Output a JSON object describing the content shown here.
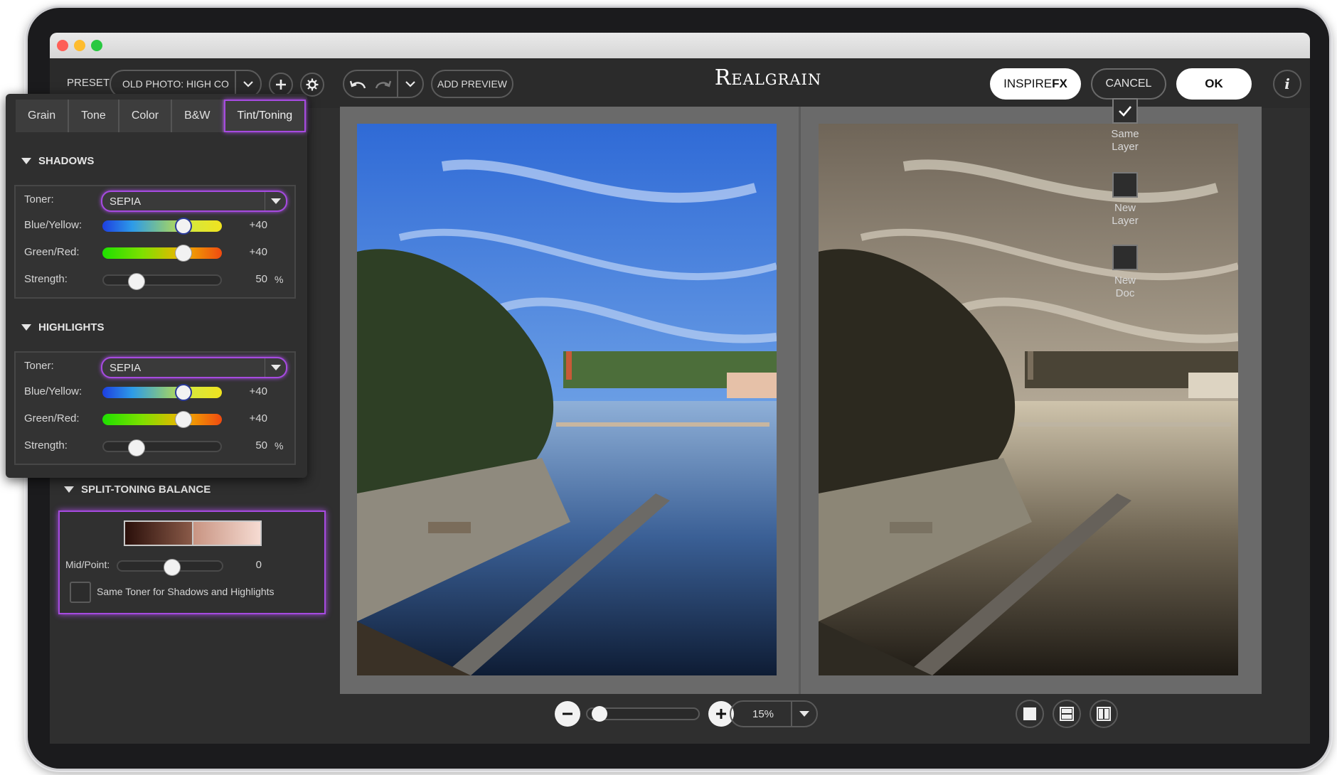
{
  "toolbar": {
    "preset_label": "PRESET",
    "preset_value": "OLD PHOTO: HIGH CON",
    "add_preview_label": "ADD PREVIEW",
    "brand": "Realgrain",
    "inspire_prefix": "INSPIRE",
    "inspire_suffix": "FX",
    "cancel_label": "CANCEL",
    "ok_label": "OK",
    "info_label": "i"
  },
  "tabs": [
    {
      "label": "Grain"
    },
    {
      "label": "Tone"
    },
    {
      "label": "Color"
    },
    {
      "label": "B&W"
    },
    {
      "label": "Tint/Toning"
    }
  ],
  "shadows": {
    "title": "SHADOWS",
    "toner_label": "Toner:",
    "toner_value": "SEPIA",
    "blue_yellow_label": "Blue/Yellow:",
    "blue_yellow_value": "+40",
    "green_red_label": "Green/Red:",
    "green_red_value": "+40",
    "strength_label": "Strength:",
    "strength_value": "50",
    "strength_unit": "%"
  },
  "highlights": {
    "title": "HIGHLIGHTS",
    "toner_label": "Toner:",
    "toner_value": "SEPIA",
    "blue_yellow_label": "Blue/Yellow:",
    "blue_yellow_value": "+40",
    "green_red_label": "Green/Red:",
    "green_red_value": "+40",
    "strength_label": "Strength:",
    "strength_value": "50",
    "strength_unit": "%"
  },
  "split_toning": {
    "title": "SPLIT-TONING BALANCE",
    "midpoint_label": "Mid/Point:",
    "midpoint_value": "0",
    "same_toner_label": "Same Toner for Shadows and Highlights",
    "same_toner_checked": false
  },
  "side_options": {
    "same_layer": "Same Layer",
    "same_layer_line1": "Same",
    "same_layer_line2": "Layer",
    "same_layer_checked": true,
    "new_layer_line1": "New",
    "new_layer_line2": "Layer",
    "new_doc_line1": "New",
    "new_doc_line2": "Doc"
  },
  "zoom": {
    "value": "15%",
    "slider_level": 0.05
  },
  "colors": {
    "accent": "#a64be0",
    "sepia_dark": "#3a1a12",
    "sepia_light": "#f2d6cc"
  }
}
